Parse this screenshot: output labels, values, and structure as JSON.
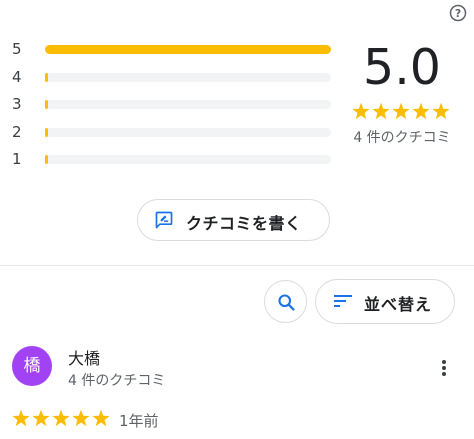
{
  "help": {
    "icon": "help-circle-icon"
  },
  "rating_bars": [
    {
      "label": "5",
      "fraction": 1.0
    },
    {
      "label": "4",
      "fraction": 0.0
    },
    {
      "label": "3",
      "fraction": 0.0
    },
    {
      "label": "2",
      "fraction": 0.0
    },
    {
      "label": "1",
      "fraction": 0.0
    }
  ],
  "summary": {
    "score": "5.0",
    "stars": 5,
    "review_count": "4 件のクチコミ"
  },
  "write_button": {
    "label": "クチコミを書く",
    "icon": "rate-review-icon"
  },
  "toolbar": {
    "search_icon": "search-icon",
    "sort_label": "並べ替え",
    "sort_icon": "sort-icon"
  },
  "review": {
    "avatar_letter": "橋",
    "name": "大橋",
    "subtitle": "4 件のクチコミ",
    "stars": 5,
    "date": "1年前"
  },
  "colors": {
    "star": "#fbbc04",
    "accent": "#1a73e8",
    "avatar": "#a142f4",
    "track": "#f1f3f4"
  }
}
